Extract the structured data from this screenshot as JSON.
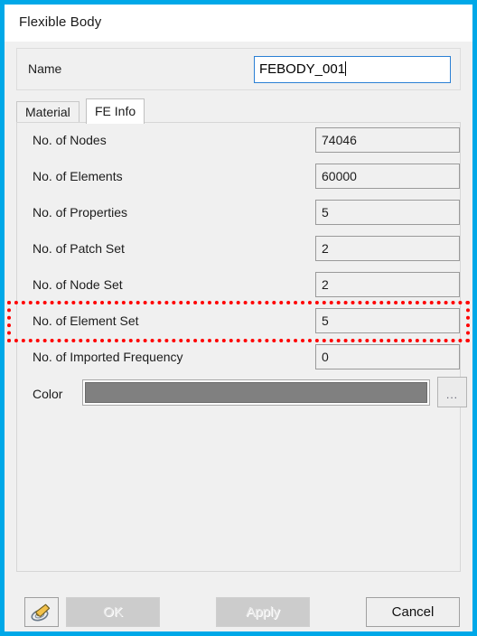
{
  "window": {
    "title": "Flexible Body",
    "accent_color": "#00a8e8",
    "background_color": "#f0f0f0"
  },
  "name_group": {
    "label": "Name",
    "value": "FEBODY_001",
    "placeholder": "",
    "focused": true
  },
  "tabs": [
    {
      "label": "Material",
      "selected": false
    },
    {
      "label": "FE Info",
      "selected": true
    }
  ],
  "fe_info": {
    "fields": [
      {
        "label": "No. of Nodes",
        "value": "74046"
      },
      {
        "label": "No. of Elements",
        "value": "60000"
      },
      {
        "label": "No. of Properties",
        "value": "5"
      },
      {
        "label": "No. of Patch Set",
        "value": "2"
      },
      {
        "label": "No. of Node Set",
        "value": "2"
      },
      {
        "label": "No. of Element Set",
        "value": "5"
      },
      {
        "label": "No. of Imported Frequency",
        "value": "0"
      }
    ],
    "color_row": {
      "label": "Color",
      "swatch_color": "#808080",
      "browse_label": "..."
    }
  },
  "annotation": {
    "highlight_color": "#ff0000",
    "highlighted_field": "No. of Element Set"
  },
  "buttons": {
    "tool": {
      "label": "",
      "icon": "paint-tool-icon",
      "enabled": true
    },
    "ok": {
      "label": "OK",
      "enabled": false
    },
    "apply": {
      "label": "Apply",
      "enabled": false
    },
    "cancel": {
      "label": "Cancel",
      "enabled": true
    }
  }
}
